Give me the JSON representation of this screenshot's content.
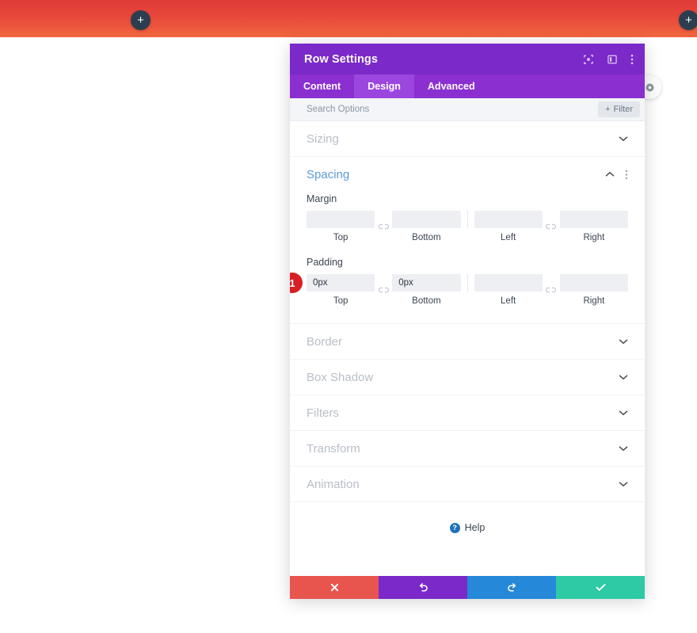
{
  "page": {
    "background": "#ffffff",
    "top_band": {
      "gradient_from": "#df3b37",
      "gradient_to": "#f2663f",
      "add_left": {
        "icon": "plus-icon",
        "label": "+"
      },
      "add_right": {
        "icon": "plus-icon",
        "label": "+"
      }
    },
    "floating_button": {
      "icon": "settings-circle-icon",
      "label": "⚙"
    }
  },
  "modal": {
    "title": "Row Settings",
    "header_icons": [
      {
        "name": "expand-icon"
      },
      {
        "name": "layout-panel-icon"
      },
      {
        "name": "more-vertical-icon"
      }
    ],
    "tabs": [
      {
        "label": "Content",
        "active": false
      },
      {
        "label": "Design",
        "active": true
      },
      {
        "label": "Advanced",
        "active": false
      }
    ],
    "search": {
      "placeholder": "Search Options",
      "value": ""
    },
    "filter": {
      "label": "Filter",
      "icon": "plus-icon",
      "prefix": "+"
    },
    "sections": [
      {
        "label": "Sizing",
        "open": false
      },
      {
        "label": "Spacing",
        "open": true
      },
      {
        "label": "Border",
        "open": false
      },
      {
        "label": "Box Shadow",
        "open": false
      },
      {
        "label": "Filters",
        "open": false
      },
      {
        "label": "Transform",
        "open": false
      },
      {
        "label": "Animation",
        "open": false
      }
    ],
    "spacing": {
      "margin": {
        "label": "Margin",
        "top": {
          "caption": "Top",
          "value": "",
          "placeholder": ""
        },
        "bottom": {
          "caption": "Bottom",
          "value": "",
          "placeholder": ""
        },
        "left": {
          "caption": "Left",
          "value": "",
          "placeholder": ""
        },
        "right": {
          "caption": "Right",
          "value": "",
          "placeholder": ""
        }
      },
      "padding": {
        "label": "Padding",
        "marker": "1",
        "top": {
          "caption": "Top",
          "value": "0px",
          "placeholder": ""
        },
        "bottom": {
          "caption": "Bottom",
          "value": "0px",
          "placeholder": ""
        },
        "left": {
          "caption": "Left",
          "value": "",
          "placeholder": ""
        },
        "right": {
          "caption": "Right",
          "value": "",
          "placeholder": ""
        }
      },
      "link_icon": "broken-link-icon"
    },
    "help": {
      "label": "Help",
      "icon": "question-circle-icon",
      "glyph": "?"
    },
    "footer": [
      {
        "name": "cancel-button",
        "icon": "close-icon",
        "color": "#e8554e"
      },
      {
        "name": "undo-button",
        "icon": "undo-icon",
        "color": "#7b29c9"
      },
      {
        "name": "redo-button",
        "icon": "redo-icon",
        "color": "#2688d8"
      },
      {
        "name": "save-button",
        "icon": "check-icon",
        "color": "#2ecaa5"
      }
    ],
    "colors": {
      "header": "#7b29c9",
      "tabbar": "#8b2fd1",
      "tab_active": "#9b46de",
      "section_active_text": "#5b9bd8",
      "badge": "#d81f26"
    }
  }
}
